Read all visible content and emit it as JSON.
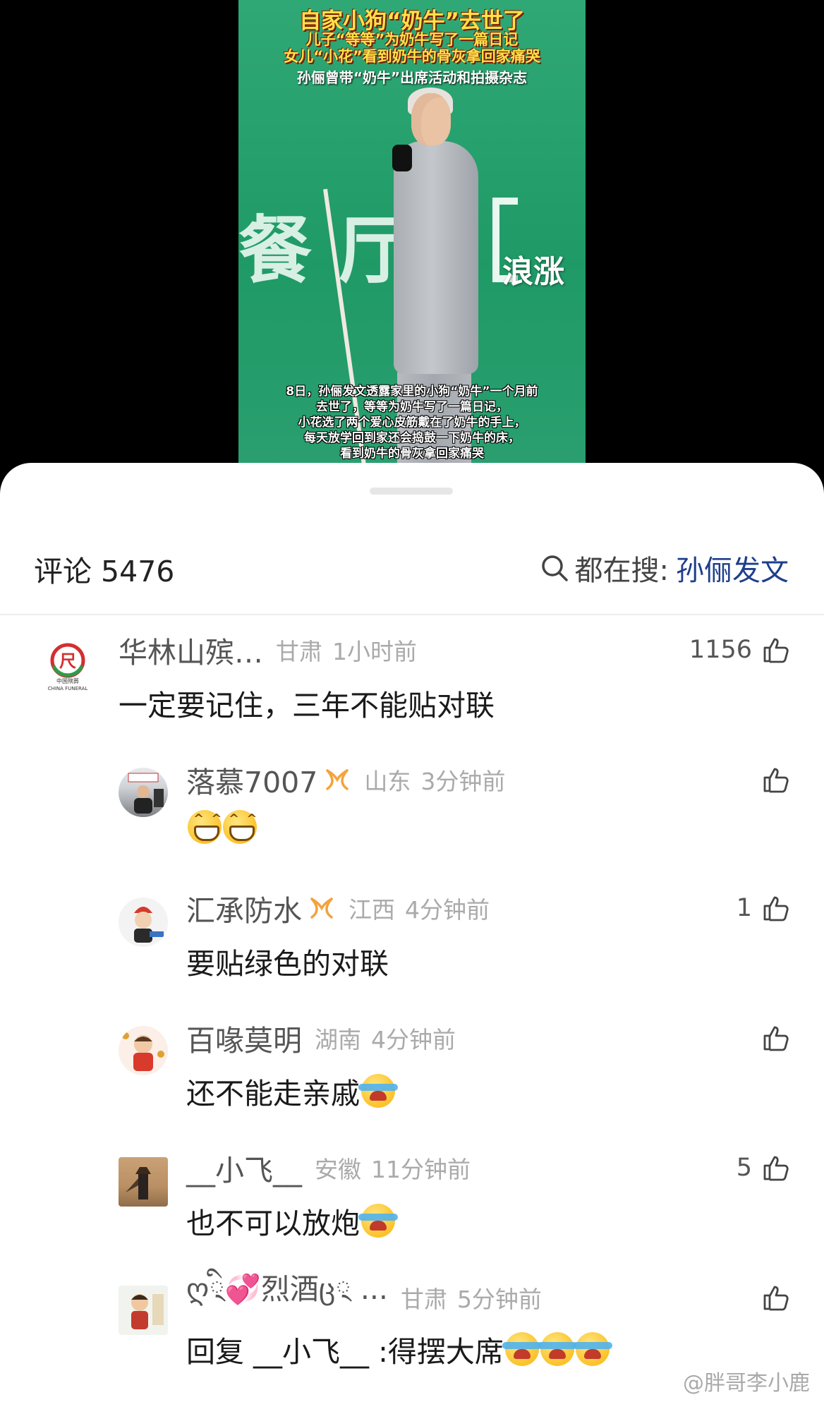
{
  "video": {
    "title": "自家小狗“奶牛”去世了",
    "subtitle_1": "儿子“等等”为奶牛写了一篇日记",
    "subtitle_2": "女儿“小花”看到奶牛的骨灰拿回家痛哭",
    "subtitle_3": "孙俪曾带“奶牛”出席活动和拍摄杂志",
    "background_text": "餐厅",
    "logo": "浪涨",
    "caption_lines": [
      "8日，孙俪发文透露家里的小狗“奶牛”一个月前",
      "去世了，等等为奶牛写了一篇日记，",
      "小花选了两个爱心皮筋戴在了奶牛的手上，",
      "每天放学回到家还会捣鼓一下奶牛的床，",
      "看到奶牛的骨灰拿回家痛哭"
    ]
  },
  "sheet": {
    "comments_title": "评论 5476",
    "search_label": "都在搜:",
    "search_topic": "孙俪发文"
  },
  "comments": [
    {
      "user": "华林山殡…",
      "location": "甘肃",
      "time": "1小时前",
      "likes": "1156",
      "text": "一定要记住，三年不能贴对联"
    },
    {
      "user": "落慕7007",
      "location": "山东",
      "time": "3分钟前",
      "likes": "",
      "text": ""
    },
    {
      "user": "汇承防水",
      "location": "江西",
      "time": "4分钟前",
      "likes": "1",
      "text": "要贴绿色的对联"
    },
    {
      "user": "百喙莫明",
      "location": "湖南",
      "time": "4分钟前",
      "likes": "",
      "text": "还不能走亲戚"
    },
    {
      "user": "__小飞__",
      "location": "安徽",
      "time": "11分钟前",
      "likes": "5",
      "text": "也不可以放炮"
    },
    {
      "user": "ღ྄ི💞烈酒ც྄ ...",
      "location": "甘肃",
      "time": "5分钟前",
      "likes": "",
      "text": "回复 __小飞__ :得摆大席"
    }
  ],
  "avatar_texts": {
    "funeral_logo_line": "中国殡葬",
    "funeral_logo_en": "CHINA FUNERAL"
  },
  "watermark": "@胖哥李小鹿",
  "colors": {
    "video_green": "#2fa876",
    "title_yellow": "#ffe14a",
    "topic_blue": "#1f3f8c",
    "meta_gray": "#aaaaaa",
    "badge_orange": "#f4a33a"
  }
}
